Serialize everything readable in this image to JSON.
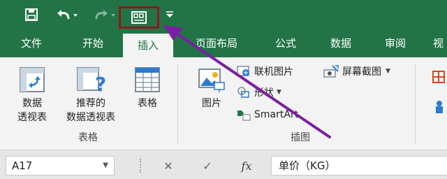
{
  "tabs": [
    "文件",
    "开始",
    "插入",
    "页面布局",
    "公式",
    "数据",
    "审阅",
    "视"
  ],
  "active_tab": "插入",
  "groups": {
    "tables": {
      "label": "表格",
      "pivot_table": [
        "数据",
        "透视表"
      ],
      "recommended_pivot": [
        "推荐的",
        "数据透视表"
      ],
      "table": "表格"
    },
    "illustrations": {
      "label": "插图",
      "pictures": "图片",
      "online_pictures": "联机图片",
      "shapes": "形状",
      "smartart": "SmartArt",
      "screenshot": "屏幕截图"
    }
  },
  "formula_bar": {
    "name_box": "A17",
    "formula": "单价（KG）"
  },
  "colors": {
    "brand_green": "#227447",
    "highlight_box": "#8b1a1a",
    "arrow": "#7a1fa2"
  }
}
